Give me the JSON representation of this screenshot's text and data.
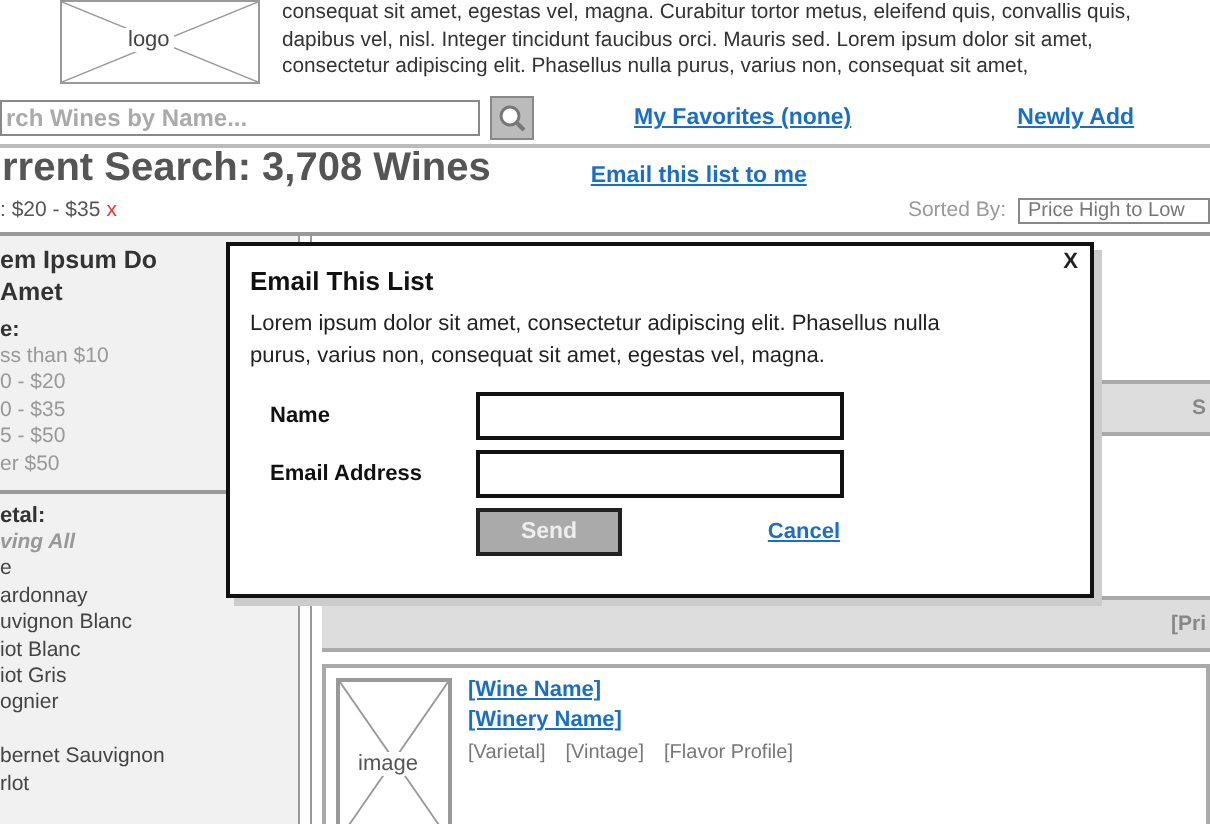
{
  "header": {
    "logo": "logo",
    "blurb": "consequat sit amet, egestas vel, magna. Curabitur tortor metus, eleifend quis, convallis quis, dapibus vel, nisl. Integer tincidunt faucibus orci. Mauris sed. Lorem ipsum dolor sit amet, consectetur adipiscing elit. Phasellus nulla purus, varius non, consequat sit amet,"
  },
  "search": {
    "placeholder": "rch Wines by Name..."
  },
  "nav_links": [
    "My Favorites (none)",
    "Newly Add"
  ],
  "results": {
    "heading": "rrent Search: 3,708 Wines",
    "email_link": "Email this list to me",
    "filter": ": $20 - $35",
    "remove_filter": "x",
    "sort_label": "Sorted By:",
    "sort_value": "Price High to Low"
  },
  "sidebar": {
    "title": "em Ipsum Do Amet",
    "sections": [
      {
        "heading": "e:",
        "items": [
          {
            "label": "ss than $10",
            "kind": "option"
          },
          {
            "label": "0 - $20",
            "kind": "option"
          },
          {
            "label": "0 - $35",
            "kind": "option"
          },
          {
            "label": "5 - $50",
            "kind": "option"
          },
          {
            "label": "er $50",
            "kind": "option"
          }
        ]
      },
      {
        "heading": "etal:",
        "items": [
          {
            "label": "ving All",
            "kind": "note"
          },
          {
            "label": "e",
            "kind": "option"
          },
          {
            "label": "ardonnay",
            "kind": "option"
          },
          {
            "label": "uvignon Blanc",
            "kind": "option"
          },
          {
            "label": "iot Blanc",
            "kind": "option"
          },
          {
            "label": "iot Gris",
            "kind": "option"
          },
          {
            "label": "ognier",
            "kind": "option"
          },
          {
            "kind": "gap"
          },
          {
            "label": "bernet Sauvignon",
            "kind": "option"
          },
          {
            "label": "rlot",
            "kind": "option"
          }
        ]
      }
    ]
  },
  "list_bars": [
    {
      "column_1": "S"
    },
    {
      "column_1": "[Pri"
    }
  ],
  "wine": {
    "image": "image",
    "name": "[Wine Name]",
    "winery": "[Winery Name]",
    "details": [
      "[Varietal]",
      "[Vintage]",
      "[Flavor Profile]"
    ]
  },
  "dialog": {
    "title": "Email This List",
    "close": "X",
    "text": "Lorem ipsum dolor sit amet, consectetur adipiscing elit. Phasellus nulla purus, varius non, consequat sit amet, egestas vel, magna.",
    "fields": [
      {
        "label": "Name"
      },
      {
        "label": "Email Address"
      }
    ],
    "send": {
      "label": "Send",
      "disabled": true
    },
    "cancel": "Cancel"
  }
}
